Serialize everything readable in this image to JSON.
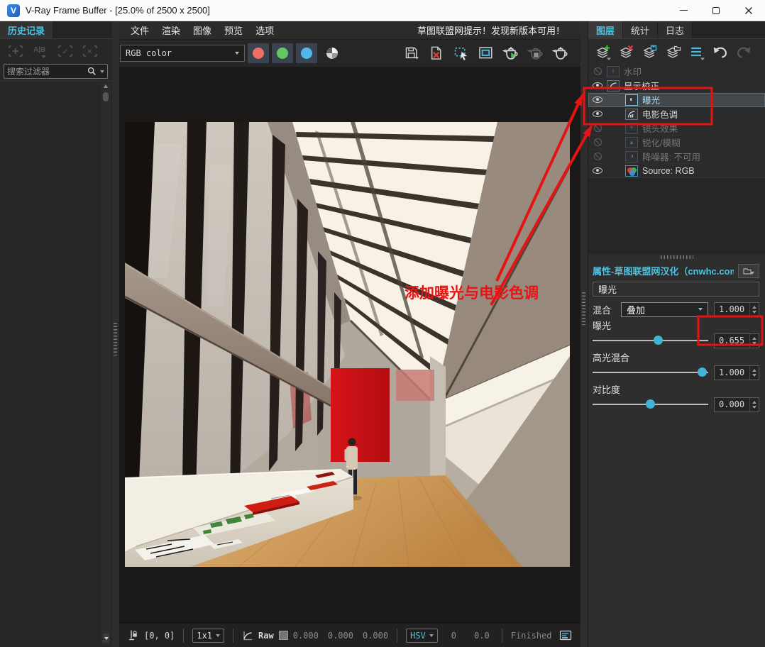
{
  "titlebar": {
    "title": "V-Ray Frame Buffer - [25.0% of 2500 x 2500]"
  },
  "history_panel": {
    "tab": "历史记录",
    "search_placeholder": "搜索过滤器"
  },
  "menubar": {
    "items": [
      "文件",
      "渲染",
      "图像",
      "预览",
      "选项"
    ],
    "notice": "草图联盟网提示！发现新版本可用！"
  },
  "toolbar": {
    "channel_value": "RGB color"
  },
  "right_panel": {
    "tabs": [
      "图层",
      "统计",
      "日志"
    ],
    "layers": [
      {
        "label": "水印",
        "enabled": false
      },
      {
        "label": "显示校正",
        "enabled": true
      },
      {
        "label": "曝光",
        "enabled": true,
        "selected": true
      },
      {
        "label": "电影色调",
        "enabled": true
      },
      {
        "label": "镜头效果",
        "enabled": false
      },
      {
        "label": "锐化/模糊",
        "enabled": false
      },
      {
        "label": "降噪器: 不可用",
        "enabled": false
      },
      {
        "label": "Source: RGB",
        "enabled": true
      }
    ]
  },
  "properties": {
    "header": "属性-草图联盟网汉化（cnwhc.com）",
    "section": "曝光",
    "blend_label": "混合",
    "blend_value": "叠加",
    "blend_amount": "1.000",
    "exposure_label": "曝光",
    "exposure_value": "0.655",
    "highlight_label": "高光混合",
    "highlight_value": "1.000",
    "contrast_label": "对比度",
    "contrast_value": "0.000"
  },
  "statusbar": {
    "coords": "[0, 0]",
    "pixel_ratio": "1x1",
    "raw_label": "Raw",
    "r": "0.000",
    "g": "0.000",
    "b": "0.000",
    "color_mode": "HSV",
    "h": "0",
    "s": "0.0",
    "state": "Finished"
  },
  "annotation": {
    "label": "添加曝光与电影色调",
    "color": "#e81414"
  },
  "icons": {
    "vray_logo": "V",
    "ab_compare": "A|B",
    "plus": "+",
    "check": "✓",
    "cross": "×",
    "watermark": "i",
    "exposure_half": "◐",
    "denoise_half": "◑",
    "lens_plus": "+",
    "sharpen": "▲"
  },
  "colors": {
    "accent_cyan": "#4fc1e0",
    "annotation_red": "#e81414",
    "dot_red": "#ef6e66",
    "dot_green": "#63c763",
    "dot_blue": "#54b7e8",
    "selection": "#45484b"
  }
}
